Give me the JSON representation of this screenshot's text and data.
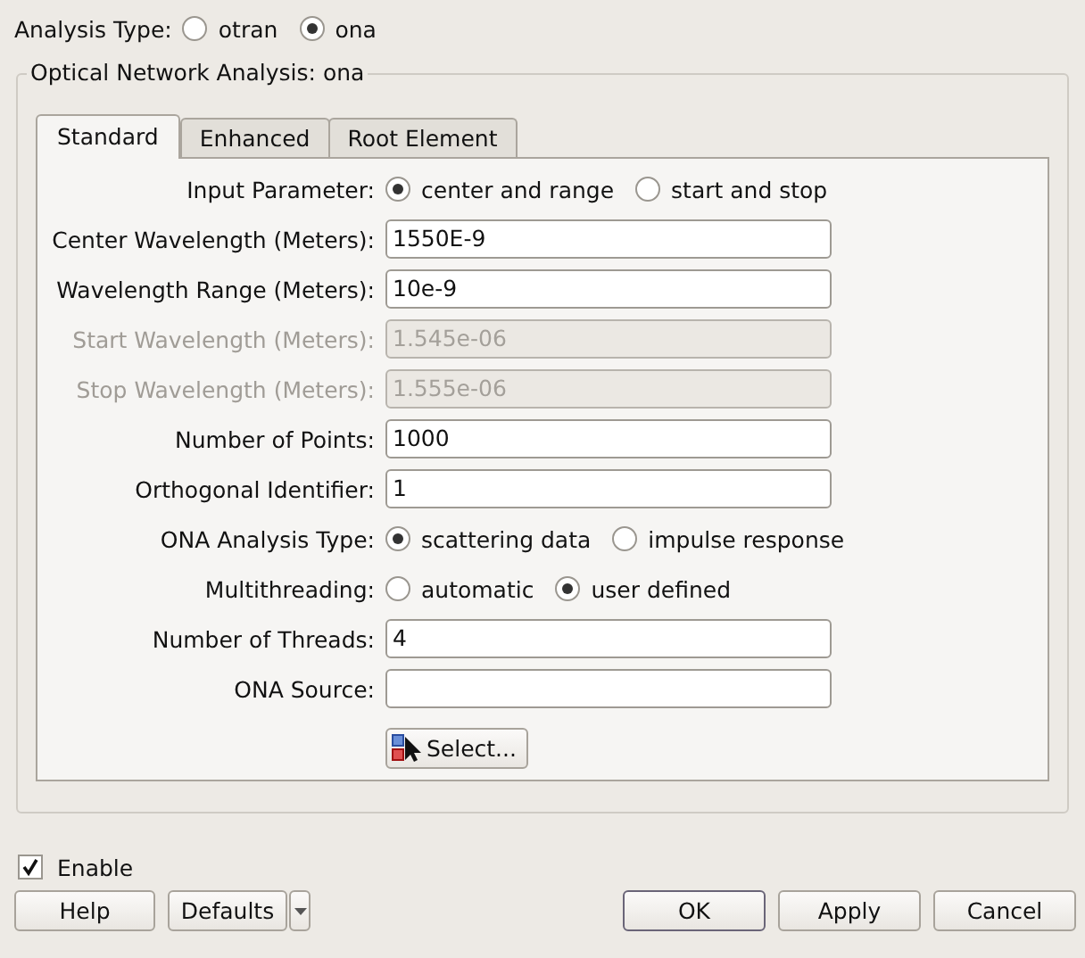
{
  "analysis_type": {
    "label": "Analysis Type:",
    "options": [
      {
        "label": "otran",
        "selected": false
      },
      {
        "label": "ona",
        "selected": true
      }
    ]
  },
  "group": {
    "title": "Optical Network Analysis: ona",
    "tabs": [
      {
        "label": "Standard",
        "selected": true
      },
      {
        "label": "Enhanced",
        "selected": false
      },
      {
        "label": "Root Element",
        "selected": false
      }
    ],
    "rows": [
      {
        "kind": "radio",
        "label": "Input Parameter:",
        "options": [
          {
            "label": "center and range",
            "selected": true
          },
          {
            "label": "start and stop",
            "selected": false
          }
        ]
      },
      {
        "kind": "field",
        "label": "Center Wavelength (Meters):",
        "value": "1550E-9",
        "disabled": false
      },
      {
        "kind": "field",
        "label": "Wavelength Range (Meters):",
        "value": "10e-9",
        "disabled": false
      },
      {
        "kind": "field",
        "label": "Start Wavelength (Meters):",
        "value": "1.545e-06",
        "disabled": true
      },
      {
        "kind": "field",
        "label": "Stop Wavelength (Meters):",
        "value": "1.555e-06",
        "disabled": true
      },
      {
        "kind": "field",
        "label": "Number of Points:",
        "value": "1000",
        "disabled": false
      },
      {
        "kind": "field",
        "label": "Orthogonal Identifier:",
        "value": "1",
        "disabled": false
      },
      {
        "kind": "radio",
        "label": "ONA Analysis Type:",
        "options": [
          {
            "label": "scattering data",
            "selected": true
          },
          {
            "label": "impulse response",
            "selected": false
          }
        ]
      },
      {
        "kind": "radio",
        "label": "Multithreading:",
        "options": [
          {
            "label": "automatic",
            "selected": false
          },
          {
            "label": "user defined",
            "selected": true
          }
        ]
      },
      {
        "kind": "field",
        "label": "Number of Threads:",
        "value": "4",
        "disabled": false
      },
      {
        "kind": "field",
        "label": "ONA Source:",
        "disabled": false
      },
      {
        "kind": "button",
        "label": "Select..."
      }
    ]
  },
  "enable": {
    "label": "Enable",
    "checked": true
  },
  "buttons_left": [
    {
      "label": "Help"
    },
    {
      "label": "Defaults"
    }
  ],
  "buttons_right": [
    {
      "label": "OK",
      "default": true
    },
    {
      "label": "Apply",
      "default": false
    },
    {
      "label": "Cancel",
      "default": false
    }
  ]
}
